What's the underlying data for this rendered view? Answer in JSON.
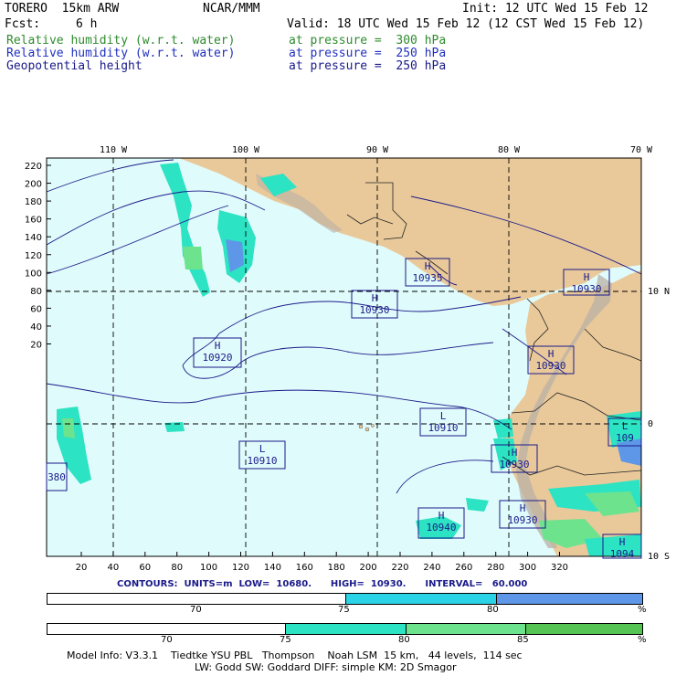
{
  "header": {
    "model": "TORERO  15km ARW",
    "org": "NCAR/MMM",
    "init": "Init: 12 UTC Wed 15 Feb 12",
    "fcst_label": "Fcst:",
    "fcst_value": "6 h",
    "valid": "Valid: 18 UTC Wed 15 Feb 12 (12 CST Wed 15 Feb 12)",
    "fields": [
      {
        "name": "Relative humidity (w.r.t. water)",
        "level": "at pressure =  300 hPa",
        "color": "#2e8b2e"
      },
      {
        "name": "Relative humidity (w.r.t. water)",
        "level": "at pressure =  250 hPa",
        "color": "#2030c0"
      },
      {
        "name": "Geopotential height",
        "level": "at pressure =  250 hPa",
        "color": "#1a1a8a"
      }
    ]
  },
  "map": {
    "top_lon_labels": [
      "110 W",
      "100 W",
      "90 W",
      "80 W",
      "70 W"
    ],
    "right_lat_labels": [
      "10 N",
      "0",
      "10 S"
    ],
    "left_ticks": [
      "220",
      "200",
      "180",
      "160",
      "140",
      "120",
      "100",
      "80",
      "60",
      "40",
      "20"
    ],
    "bottom_ticks": [
      "20",
      "40",
      "60",
      "80",
      "100",
      "120",
      "140",
      "160",
      "180",
      "200",
      "220",
      "240",
      "260",
      "280",
      "300",
      "320"
    ],
    "ocean_color": "#e0fbfb",
    "land_color": "#e9c99a",
    "boxes": [
      {
        "type": "H",
        "value": "10935"
      },
      {
        "type": "H",
        "value": "10930"
      },
      {
        "type": "H",
        "value": "10930"
      },
      {
        "type": "H",
        "value": "10920"
      },
      {
        "type": "H",
        "value": "10930"
      },
      {
        "type": "L",
        "value": "10910"
      },
      {
        "type": "L",
        "value": "10910"
      },
      {
        "type": "H",
        "value": "10930"
      },
      {
        "type": "H",
        "value": "10940"
      },
      {
        "type": "H",
        "value": "10930"
      },
      {
        "type": "L",
        "value": "109"
      },
      {
        "type": "",
        "value": "380"
      },
      {
        "type": "H",
        "value": "1094"
      }
    ]
  },
  "contours_line": {
    "label": "CONTOURS:  UNITS=m  LOW=  10680.      HIGH=  10930.      INTERVAL=   60.000"
  },
  "colorbar1": {
    "ticks": [
      "70",
      "75",
      "80"
    ],
    "unit": "%",
    "segments": [
      {
        "color": "#ffffff"
      },
      {
        "color": "#2bd3e6"
      },
      {
        "color": "#5e97e8"
      }
    ]
  },
  "colorbar2": {
    "ticks": [
      "70",
      "75",
      "80",
      "85"
    ],
    "unit": "%",
    "segments": [
      {
        "color": "#ffffff"
      },
      {
        "color": "#2ce3c3"
      },
      {
        "color": "#6ee38e"
      },
      {
        "color": "#55c455"
      }
    ]
  },
  "footer": {
    "line1": "Model Info: V3.3.1    Tiedtke YSU PBL   Thompson    Noah LSM  15 km,   44 levels,  114 sec",
    "line2": "LW: Godd SW: Goddard DIFF: simple KM: 2D Smagor"
  }
}
